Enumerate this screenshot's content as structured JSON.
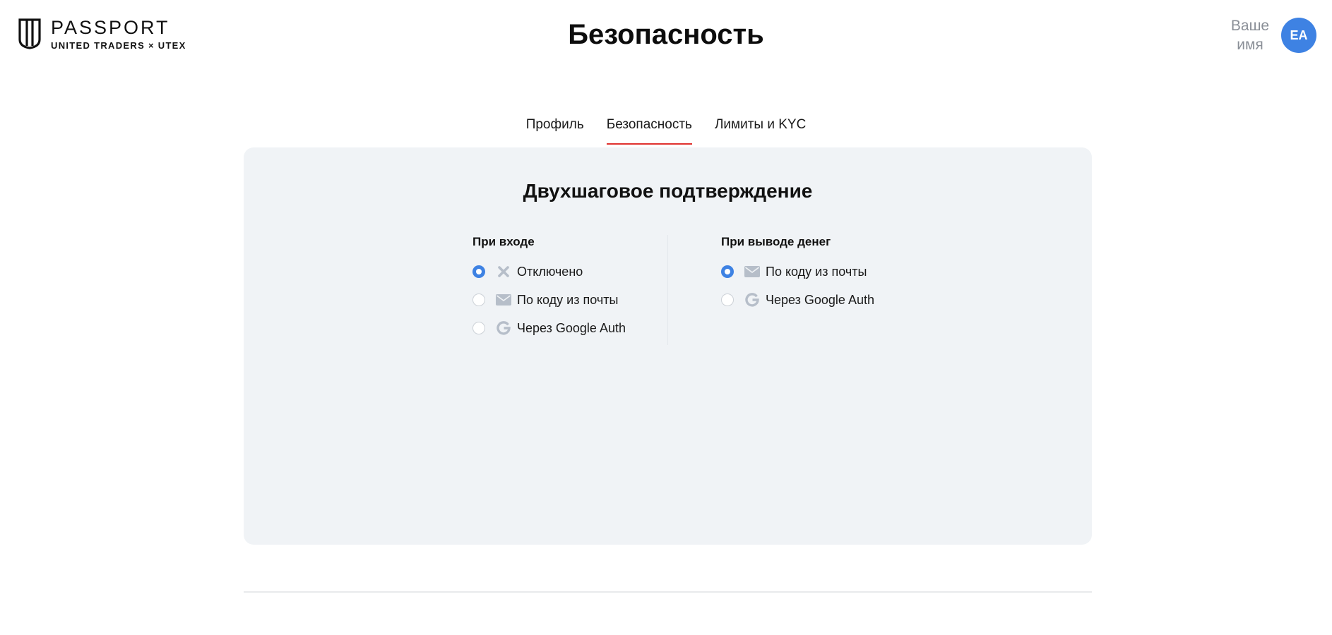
{
  "brand": {
    "title": "PASSPORT",
    "subtitle": "UNITED TRADERS × UTEX"
  },
  "page": {
    "title": "Безопасность"
  },
  "user": {
    "name_line1": "Ваше",
    "name_line2": "имя",
    "initials": "EA"
  },
  "tabs": [
    {
      "label": "Профиль",
      "active": false
    },
    {
      "label": "Безопасность",
      "active": true
    },
    {
      "label": "Лимиты и KYC",
      "active": false
    }
  ],
  "two_factor": {
    "title": "Двухшаговое подтверждение",
    "login": {
      "title": "При входе",
      "options": [
        {
          "label": "Отключено",
          "icon": "close-icon",
          "checked": true
        },
        {
          "label": "По коду из почты",
          "icon": "mail-icon",
          "checked": false
        },
        {
          "label": "Через Google Auth",
          "icon": "google-icon",
          "checked": false
        }
      ]
    },
    "withdraw": {
      "title": "При выводе денег",
      "options": [
        {
          "label": "По коду из почты",
          "icon": "mail-icon",
          "checked": true
        },
        {
          "label": "Через Google Auth",
          "icon": "google-icon",
          "checked": false
        }
      ]
    }
  },
  "colors": {
    "accent_blue": "#3e82e3",
    "tab_underline_red": "#e0322f",
    "card_bg": "#f0f3f6",
    "icon_gray": "#b6bec9"
  }
}
